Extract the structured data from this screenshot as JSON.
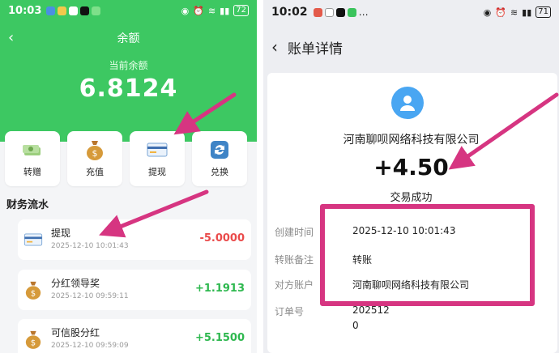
{
  "left_phone": {
    "status_bar": {
      "time": "10:03",
      "battery": "72"
    },
    "header": {
      "title": "余额"
    },
    "balance": {
      "label": "当前余额",
      "value": "6.8124"
    },
    "actions": [
      {
        "label": "转赠",
        "icon": "money-stack-icon"
      },
      {
        "label": "充值",
        "icon": "money-bag-icon"
      },
      {
        "label": "提现",
        "icon": "bank-card-icon"
      },
      {
        "label": "兑换",
        "icon": "exchange-icon"
      }
    ],
    "section_title": "财务流水",
    "transactions": [
      {
        "title": "提现",
        "time": "2025-12-10 10:01:43",
        "amount": "-5.0000",
        "icon": "bank-card-icon"
      },
      {
        "title": "分红领导奖",
        "time": "2025-12-10 09:59:11",
        "amount": "+1.1913",
        "icon": "money-bag-icon"
      },
      {
        "title": "可信股分红",
        "time": "2025-12-10 09:59:09",
        "amount": "+5.1500",
        "icon": "money-bag-icon"
      }
    ]
  },
  "right_phone": {
    "status_bar": {
      "time": "10:02",
      "battery": "71"
    },
    "header": {
      "title": "账单详情"
    },
    "counterparty": "河南聊呗网络科技有限公司",
    "amount": "+4.50",
    "status": "交易成功",
    "details": {
      "created_label": "创建时间",
      "created_value": "2025-12-10 10:01:43",
      "remark_label": "转账备注",
      "remark_value": "转账",
      "account_label": "对方账户",
      "account_value": "河南聊呗网络科技有限公司",
      "order_label": "订单号",
      "order_value_line1": "202512",
      "order_value_line2": "0"
    }
  },
  "colors": {
    "green": "#3dc862",
    "annotation": "#d63581",
    "red": "#ea4b4b",
    "positive": "#2eb84f",
    "avatar": "#49a6f2"
  }
}
